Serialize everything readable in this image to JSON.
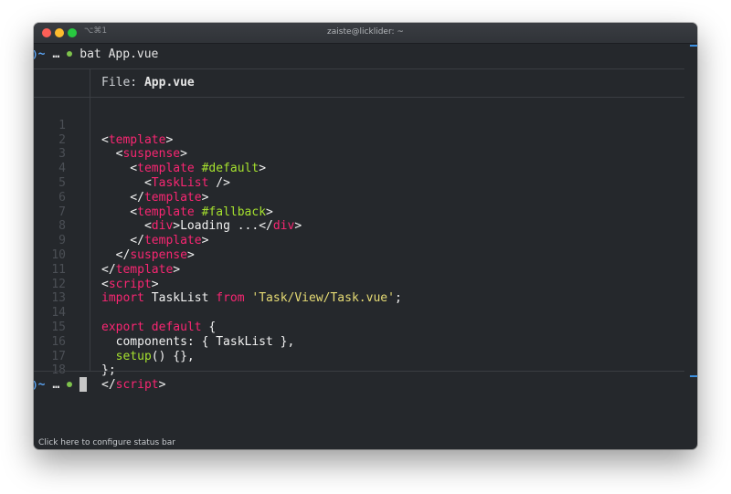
{
  "window": {
    "title": "zaiste@licklider: ~",
    "shortcut": "⌥⌘1",
    "status_bar": "Click here to configure status bar"
  },
  "prompt1": {
    "arrow": ")",
    "tilde": "~",
    "dots": "…",
    "command": "bat App.vue"
  },
  "prompt2": {
    "arrow": ")",
    "tilde": "~",
    "dots": "…"
  },
  "file": {
    "label": "File:",
    "name": "App.vue"
  },
  "code": {
    "line_numbers": [
      "1",
      "2",
      "3",
      "4",
      "5",
      "6",
      "7",
      "8",
      "9",
      "10",
      "11",
      "12",
      "13",
      "14",
      "15",
      "16",
      "17",
      "18"
    ],
    "tokens": {
      "l1": [
        "<",
        "template",
        ">"
      ],
      "l2": [
        "  <",
        "suspense",
        ">"
      ],
      "l3": [
        "    <",
        "template",
        " ",
        "#default",
        ">"
      ],
      "l4": [
        "      <",
        "TaskList",
        " />"
      ],
      "l5": [
        "    </",
        "template",
        ">"
      ],
      "l6": [
        "    <",
        "template",
        " ",
        "#fallback",
        ">"
      ],
      "l7": [
        "      <",
        "div",
        ">Loading ...</",
        "div",
        ">"
      ],
      "l8": [
        "    </",
        "template",
        ">"
      ],
      "l9": [
        "  </",
        "suspense",
        ">"
      ],
      "l10": [
        "</",
        "template",
        ">"
      ],
      "l11": [
        "<",
        "script",
        ">"
      ],
      "l12": [
        "import",
        " TaskList ",
        "from",
        " ",
        "'Task/View/Task.vue'",
        ";"
      ],
      "l14": [
        "export",
        " ",
        "default",
        " {"
      ],
      "l15": [
        "  components: { TaskList },"
      ],
      "l16": [
        "  ",
        "setup",
        "() {},"
      ],
      "l17": [
        "};"
      ],
      "l18": [
        "</",
        "script",
        ">"
      ]
    }
  },
  "colors": {
    "background": "#25282c",
    "tag": "#f92672",
    "attribute": "#a6e22e",
    "string": "#e6db74",
    "prompt_blue": "#5aa2f0",
    "prompt_green": "#7ec34c"
  }
}
